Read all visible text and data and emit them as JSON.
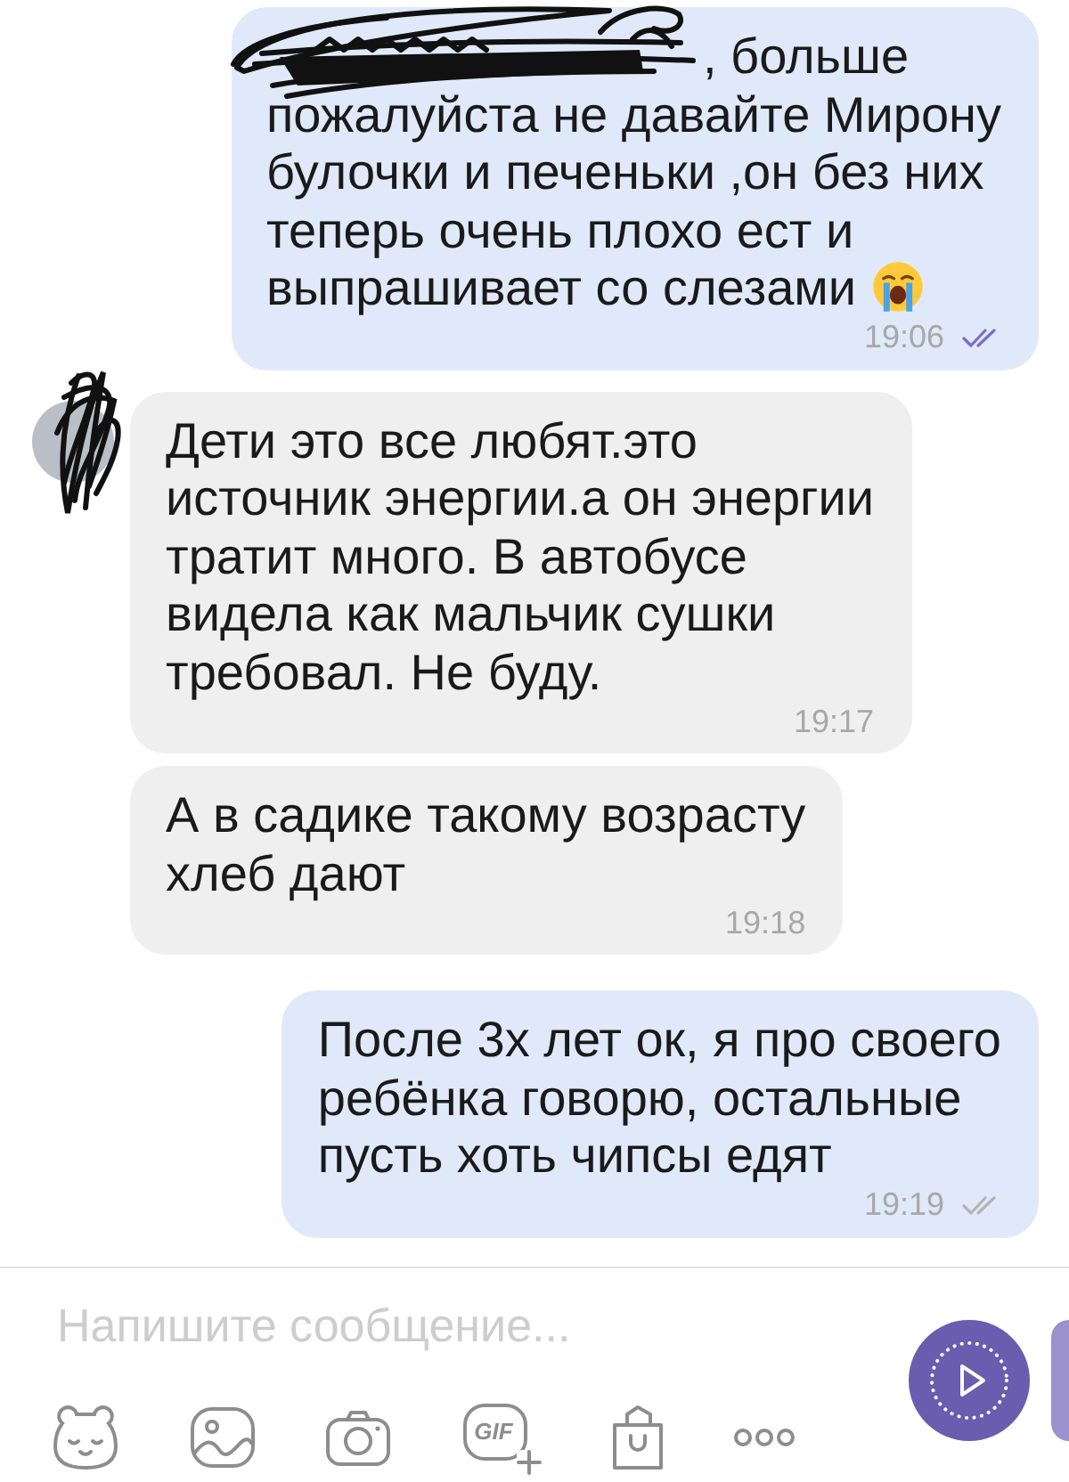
{
  "messages": [
    {
      "kind": "outgoing",
      "name_scribbled": true,
      "text": ", больше\nпожалуйста не давайте Мирону\nбулочки и печеньки ,он без них\nтеперь очень плохо ест и\nвыпрашивает со слезами",
      "ends_with_emoji": true,
      "time": "19:06",
      "read": true
    },
    {
      "kind": "incoming",
      "avatar": true,
      "text": "Дети это все любят.это\nисточник энергии.а он энергии\nтратит много. В автобусе\nвидела как мальчик сушки\nтребовал. Не буду.",
      "time": "19:17"
    },
    {
      "kind": "incoming",
      "avatar": false,
      "text": "А в садике такому возрасту\nхлеб дают",
      "time": "19:18"
    },
    {
      "kind": "outgoing",
      "name_scribbled": false,
      "text": "После 3х лет ок, я про своего\nребёнка говорю, остальные\nпусть хоть чипсы едят",
      "ends_with_emoji": false,
      "time": "19:19",
      "read": false
    }
  ],
  "composer": {
    "placeholder": "Напишите сообщение...",
    "gif_label": "GIF"
  }
}
